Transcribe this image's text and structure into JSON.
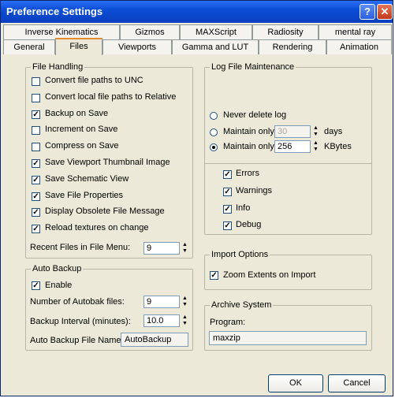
{
  "window": {
    "title": "Preference Settings",
    "help_glyph": "?",
    "close_glyph": "✕"
  },
  "tabs_row1": [
    "Inverse Kinematics",
    "Gizmos",
    "MAXScript",
    "Radiosity",
    "mental ray"
  ],
  "tabs_row2": [
    "General",
    "Files",
    "Viewports",
    "Gamma and LUT",
    "Rendering",
    "Animation"
  ],
  "active_tab": "Files",
  "file_handling": {
    "title": "File Handling",
    "options": [
      {
        "label": "Convert file paths to UNC",
        "checked": false
      },
      {
        "label": "Convert local file paths to Relative",
        "checked": false
      },
      {
        "label": "Backup on Save",
        "checked": true
      },
      {
        "label": "Increment on Save",
        "checked": false
      },
      {
        "label": "Compress on Save",
        "checked": false
      },
      {
        "label": "Save Viewport Thumbnail Image",
        "checked": true
      },
      {
        "label": "Save Schematic View",
        "checked": true
      },
      {
        "label": "Save File Properties",
        "checked": true
      },
      {
        "label": "Display Obsolete File Message",
        "checked": true
      },
      {
        "label": "Reload textures on change",
        "checked": true
      }
    ],
    "recent_files_label": "Recent Files in File Menu:",
    "recent_files_value": "9"
  },
  "auto_backup": {
    "title": "Auto Backup",
    "enable_label": "Enable",
    "enable_checked": true,
    "num_files_label": "Number of Autobak files:",
    "num_files_value": "9",
    "interval_label": "Backup Interval (minutes):",
    "interval_value": "10.0",
    "file_name_label": "Auto Backup File Name:",
    "file_name_value": "AutoBackup"
  },
  "log_file": {
    "title": "Log File Maintenance",
    "never_delete_label": "Never delete log",
    "maintain_days_label": "Maintain only",
    "maintain_days_value": "30",
    "days_unit": "days",
    "maintain_kb_label": "Maintain only",
    "maintain_kb_value": "256",
    "kb_unit": "KBytes",
    "selected": "kbytes",
    "options": [
      {
        "label": "Errors",
        "checked": true
      },
      {
        "label": "Warnings",
        "checked": true
      },
      {
        "label": "Info",
        "checked": true
      },
      {
        "label": "Debug",
        "checked": true
      }
    ]
  },
  "import_options": {
    "title": "Import Options",
    "zoom_label": "Zoom Extents on Import",
    "zoom_checked": true
  },
  "archive": {
    "title": "Archive System",
    "program_label": "Program:",
    "program_value": "maxzip"
  },
  "buttons": {
    "ok": "OK",
    "cancel": "Cancel"
  }
}
